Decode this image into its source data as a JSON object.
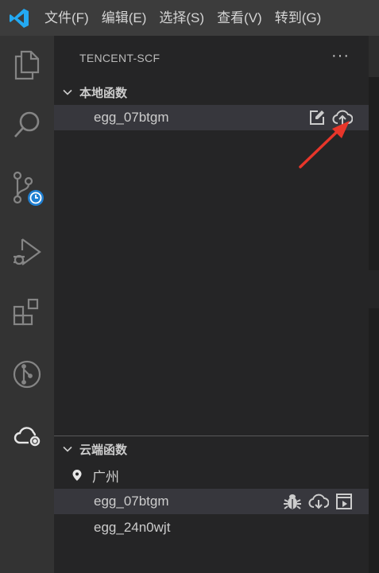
{
  "menubar": {
    "logo": "vscode-logo",
    "items": [
      {
        "label": "文件(F)"
      },
      {
        "label": "编辑(E)"
      },
      {
        "label": "选择(S)"
      },
      {
        "label": "查看(V)"
      },
      {
        "label": "转到(G)"
      }
    ]
  },
  "activitybar": {
    "icons": [
      "explorer-icon",
      "search-icon",
      "source-control-icon",
      "run-debug-icon",
      "extensions-icon",
      "git-graph-icon",
      "tencent-scf-icon"
    ]
  },
  "sidebar": {
    "title": "TENCENT-SCF",
    "more_label": "···",
    "local_section": {
      "title": "本地函数",
      "items": [
        {
          "label": "egg_07btgm",
          "actions": [
            "edit-icon",
            "deploy-cloud-upload-icon"
          ]
        }
      ]
    },
    "cloud_section": {
      "title": "云端函数",
      "region": "广州",
      "items": [
        {
          "label": "egg_07btgm",
          "actions": [
            "debug-icon",
            "cloud-download-icon",
            "invoke-icon"
          ]
        },
        {
          "label": "egg_24n0wjt",
          "actions": []
        }
      ]
    }
  },
  "colors": {
    "menubar_bg": "#3c3c3c",
    "activitybar_bg": "#333333",
    "sidebar_bg": "#252526",
    "selected_row_bg": "#37373d",
    "vscode_blue": "#23a9f2",
    "annotation_red": "#e8362a"
  }
}
